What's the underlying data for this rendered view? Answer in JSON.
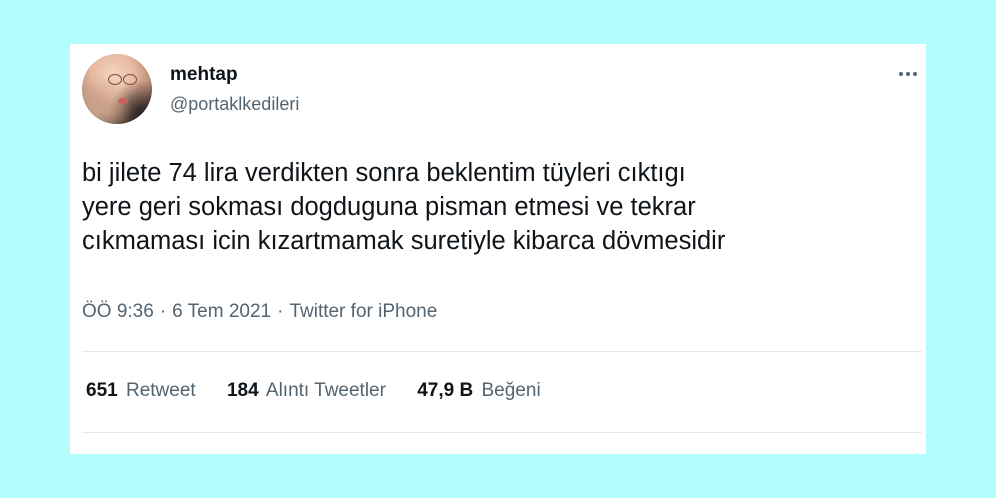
{
  "tweet": {
    "author": {
      "name": "mehtap",
      "handle": "@portaklkedileri"
    },
    "text_lines": [
      "bi jilete 74 lira verdikten sonra beklentim tüyleri cıktıgı",
      "yere geri sokması dogduguna pisman etmesi ve tekrar",
      "cıkmaması icin kızartmamak suretiyle kibarca dövmesidir"
    ],
    "time": "ÖÖ 9:36",
    "date": "6 Tem 2021",
    "source": "Twitter for iPhone",
    "separator": "·",
    "stats": {
      "retweets": {
        "count": "651",
        "label": "Retweet"
      },
      "quotes": {
        "count": "184",
        "label": "Alıntı Tweetler"
      },
      "likes": {
        "count": "47,9 B",
        "label": "Beğeni"
      }
    },
    "more_icon": "more-horizontal-icon"
  },
  "colors": {
    "background": "#b3fdfc",
    "card": "#ffffff",
    "primary_text": "#0f1419",
    "secondary_text": "#536471",
    "divider": "#e4e8eb"
  }
}
